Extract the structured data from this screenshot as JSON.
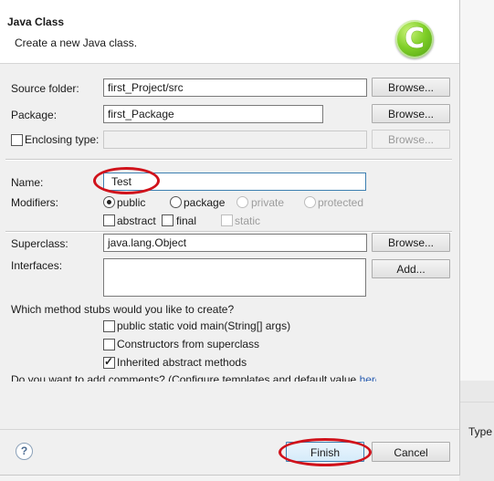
{
  "header": {
    "title": "Java Class",
    "description": "Create a new Java class.",
    "logo_letter": "C"
  },
  "source_folder": {
    "label": "Source folder:",
    "value": "first_Project/src",
    "browse": "Browse..."
  },
  "package": {
    "label": "Package:",
    "value": "first_Package",
    "browse": "Browse..."
  },
  "enclosing": {
    "label": "Enclosing type:",
    "value": "",
    "browse": "Browse..."
  },
  "name": {
    "label": "Name:",
    "value": "Test"
  },
  "modifiers": {
    "label": "Modifiers:",
    "public": "public",
    "package": "package",
    "private": "private",
    "protected": "protected",
    "abstract": "abstract",
    "final": "final",
    "static": "static"
  },
  "superclass": {
    "label": "Superclass:",
    "value": "java.lang.Object",
    "browse": "Browse..."
  },
  "interfaces": {
    "label": "Interfaces:",
    "add": "Add..."
  },
  "stubs": {
    "question": "Which method stubs would you like to create?",
    "main": "public static void main(String[] args)",
    "constructors": "Constructors from superclass",
    "inherited": "Inherited abstract methods"
  },
  "comments": {
    "text": "Do you want to add comments? (Configure templates and default value ",
    "link": "here)"
  },
  "footer": {
    "finish": "Finish",
    "cancel": "Cancel"
  },
  "background": {
    "type_label": "Type"
  },
  "annotation_color": "#d0121b"
}
